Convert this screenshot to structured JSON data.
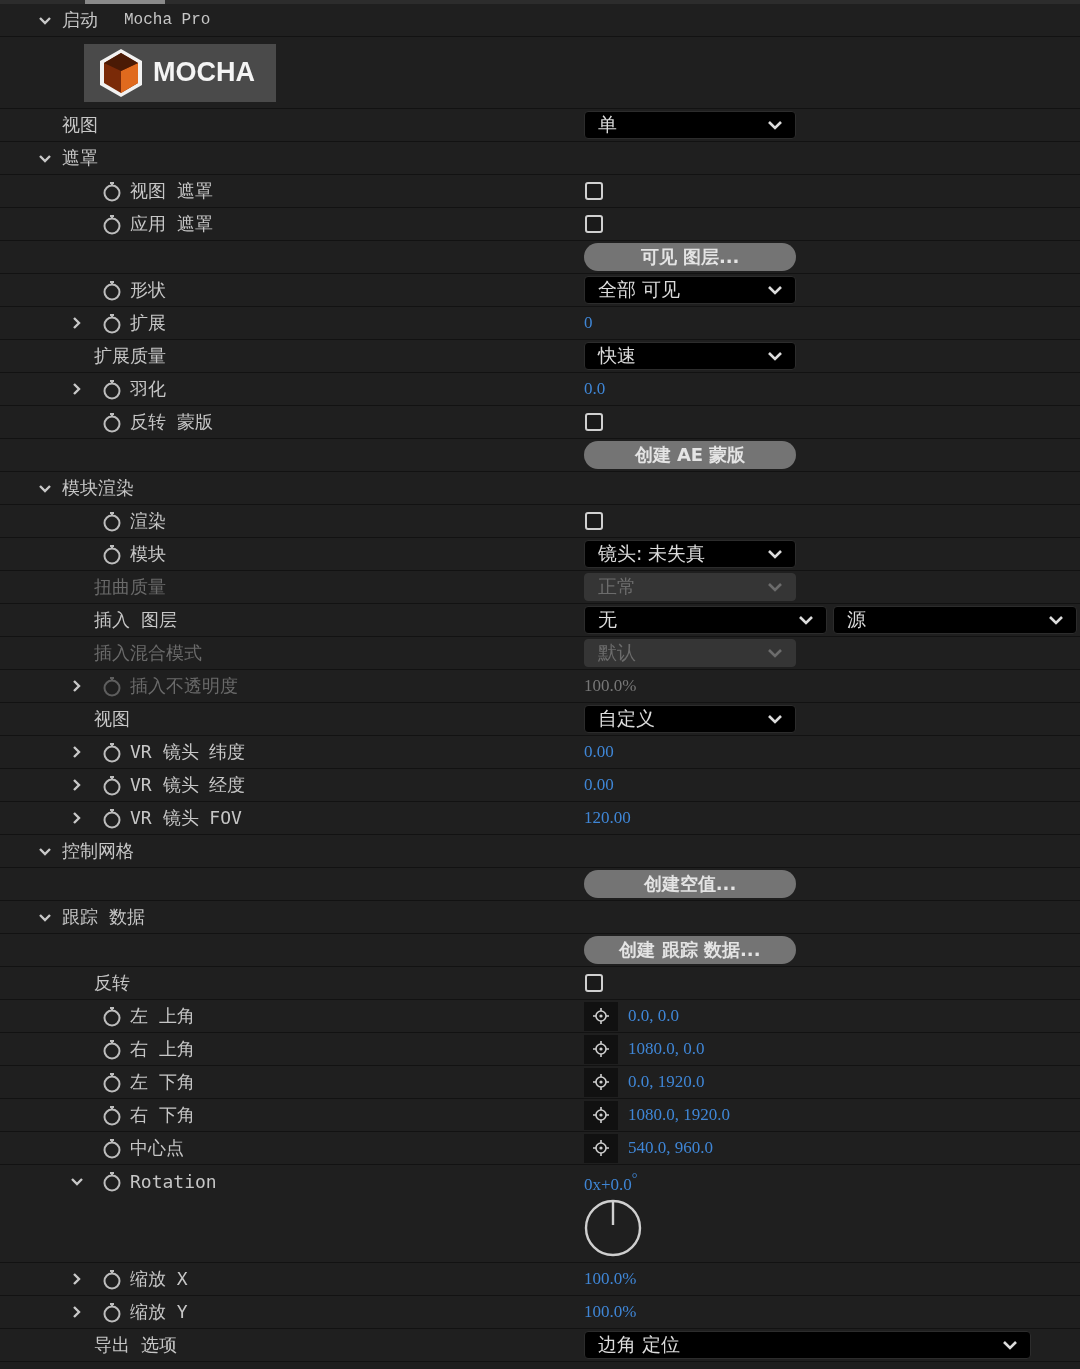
{
  "effect": {
    "label": "启动",
    "expanded": true,
    "name": "Mocha Pro",
    "logo": "MOCHA"
  },
  "rows": [
    {
      "label": "视图",
      "animatable": false,
      "disabled": false,
      "value": {
        "kind": "dropdown",
        "text": "单"
      }
    },
    {
      "label": "遮罩",
      "expanded": true,
      "animatable": false,
      "disabled": false,
      "children": [
        {
          "label": "视图 遮罩",
          "animatable": true,
          "disabled": false,
          "value": {
            "kind": "checkbox",
            "checked": false
          }
        },
        {
          "label": "应用 遮罩",
          "animatable": true,
          "disabled": false,
          "value": {
            "kind": "checkbox",
            "checked": false
          }
        },
        {
          "animatable": false,
          "disabled": false,
          "value": {
            "kind": "button",
            "text": "可见 图层..."
          }
        },
        {
          "label": "形状",
          "animatable": true,
          "disabled": false,
          "value": {
            "kind": "dropdown",
            "text": "全部 可见"
          }
        },
        {
          "label": "扩展",
          "expanded": false,
          "animatable": true,
          "disabled": false,
          "value": {
            "kind": "number",
            "text": "0"
          }
        },
        {
          "label": "扩展质量",
          "animatable": false,
          "disabled": false,
          "value": {
            "kind": "dropdown",
            "text": "快速"
          }
        },
        {
          "label": "羽化",
          "expanded": false,
          "animatable": true,
          "disabled": false,
          "value": {
            "kind": "number",
            "text": "0.0"
          }
        },
        {
          "label": "反转 蒙版",
          "animatable": true,
          "disabled": false,
          "value": {
            "kind": "checkbox",
            "checked": false
          }
        },
        {
          "animatable": false,
          "disabled": false,
          "value": {
            "kind": "button",
            "text": "创建 AE 蒙版"
          }
        }
      ]
    },
    {
      "label": "模块渲染",
      "expanded": true,
      "animatable": false,
      "disabled": false,
      "children": [
        {
          "label": "渲染",
          "animatable": true,
          "disabled": false,
          "value": {
            "kind": "checkbox",
            "checked": false
          }
        },
        {
          "label": "模块",
          "animatable": true,
          "disabled": false,
          "value": {
            "kind": "dropdown",
            "text": "镜头: 未失真"
          }
        },
        {
          "label": "扭曲质量",
          "animatable": false,
          "disabled": true,
          "value": {
            "kind": "dropdown",
            "text": "正常"
          }
        },
        {
          "label": "插入 图层",
          "animatable": false,
          "disabled": false,
          "value": {
            "kind": "dropdown-pair",
            "text": "无",
            "second": "源"
          }
        },
        {
          "label": "插入混合模式",
          "animatable": false,
          "disabled": true,
          "value": {
            "kind": "dropdown",
            "text": "默认"
          }
        },
        {
          "label": "插入不透明度",
          "expanded": false,
          "animatable": true,
          "disabled": true,
          "value": {
            "kind": "number",
            "text": "100.0%"
          }
        },
        {
          "label": "视图",
          "animatable": false,
          "disabled": false,
          "value": {
            "kind": "dropdown",
            "text": "自定义"
          }
        },
        {
          "label": "VR 镜头 纬度",
          "expanded": false,
          "animatable": true,
          "disabled": false,
          "value": {
            "kind": "number",
            "text": "0.00"
          }
        },
        {
          "label": "VR 镜头 经度",
          "expanded": false,
          "animatable": true,
          "disabled": false,
          "value": {
            "kind": "number",
            "text": "0.00"
          }
        },
        {
          "label": "VR 镜头 FOV",
          "expanded": false,
          "animatable": true,
          "disabled": false,
          "value": {
            "kind": "number",
            "text": "120.00"
          }
        }
      ]
    },
    {
      "label": "控制网格",
      "expanded": true,
      "animatable": false,
      "disabled": false,
      "children": [
        {
          "animatable": false,
          "disabled": false,
          "value": {
            "kind": "button",
            "text": "创建空值..."
          }
        }
      ]
    },
    {
      "label": "跟踪 数据",
      "expanded": true,
      "animatable": false,
      "disabled": false,
      "children": [
        {
          "animatable": false,
          "disabled": false,
          "value": {
            "kind": "button",
            "text": "创建 跟踪 数据..."
          }
        },
        {
          "label": "反转",
          "animatable": false,
          "disabled": false,
          "value": {
            "kind": "checkbox",
            "checked": false
          }
        },
        {
          "label": "左 上角",
          "animatable": true,
          "disabled": false,
          "value": {
            "kind": "point",
            "text": "0.0, 0.0"
          }
        },
        {
          "label": "右 上角",
          "animatable": true,
          "disabled": false,
          "value": {
            "kind": "point",
            "text": "1080.0, 0.0"
          }
        },
        {
          "label": "左 下角",
          "animatable": true,
          "disabled": false,
          "value": {
            "kind": "point",
            "text": "0.0, 1920.0"
          }
        },
        {
          "label": "右 下角",
          "animatable": true,
          "disabled": false,
          "value": {
            "kind": "point",
            "text": "1080.0, 1920.0"
          }
        },
        {
          "label": "中心点",
          "animatable": true,
          "disabled": false,
          "value": {
            "kind": "point",
            "text": "540.0, 960.0"
          }
        },
        {
          "label": "Rotation",
          "expanded": true,
          "animatable": true,
          "disabled": false,
          "value": {
            "kind": "angle",
            "text": "0x+0.0$^{°}$"
          }
        },
        {
          "label": "缩放 X",
          "expanded": false,
          "animatable": true,
          "disabled": false,
          "value": {
            "kind": "number",
            "text": "100.0%"
          }
        },
        {
          "label": "缩放 Y",
          "expanded": false,
          "animatable": true,
          "disabled": false,
          "value": {
            "kind": "number",
            "text": "100.0%"
          }
        },
        {
          "label": "导出 选项",
          "animatable": false,
          "disabled": false,
          "value": {
            "kind": "dropdown-wide",
            "text": "边角 定位"
          }
        }
      ]
    }
  ]
}
